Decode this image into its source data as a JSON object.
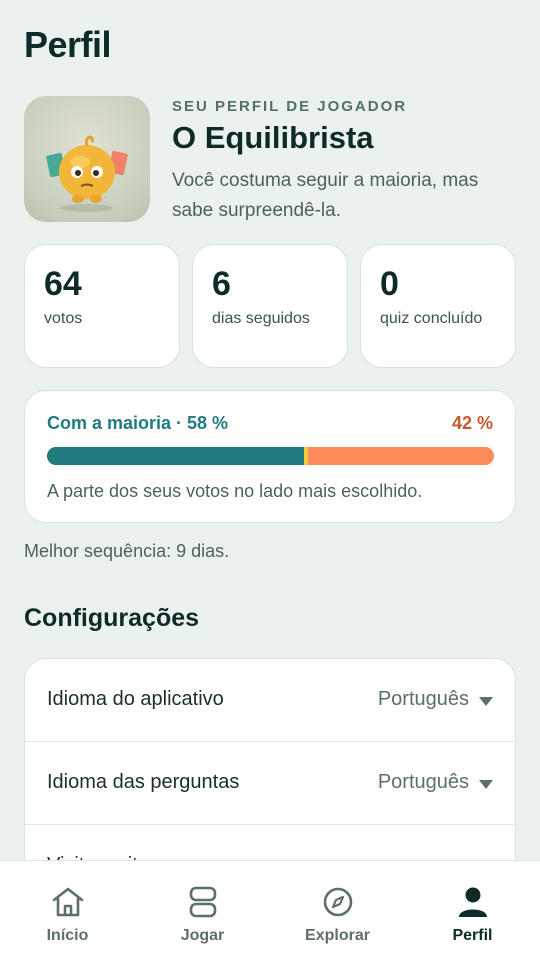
{
  "header": {
    "title": "Perfil"
  },
  "profile": {
    "kicker": "SEU PERFIL DE JOGADOR",
    "name": "O Equilibrista",
    "description": "Você costuma seguir a maioria, mas sabe surpreendê-la."
  },
  "stats": [
    {
      "value": "64",
      "label": "votos"
    },
    {
      "value": "6",
      "label": "dias seguidos"
    },
    {
      "value": "0",
      "label": "quiz concluído"
    }
  ],
  "majority": {
    "left_label": "Com a maioria · 58 %",
    "right_label": "42 %",
    "majority_percent": 58,
    "caption": "A parte dos seus votos no lado mais escolhido.",
    "colors": {
      "majority": "#237a7f",
      "minority": "#ff8c5a",
      "marker": "#f5c93a"
    }
  },
  "best_streak": "Melhor sequência: 9 dias.",
  "settings": {
    "title": "Configurações",
    "rows": [
      {
        "label": "Idioma do aplicativo",
        "value": "Português",
        "icon": "chevron-down-icon"
      },
      {
        "label": "Idioma das perguntas",
        "value": "Português",
        "icon": "chevron-down-icon"
      },
      {
        "label": "Visite o site",
        "icon": "chevron-right-icon"
      }
    ]
  },
  "nav": {
    "items": [
      {
        "label": "Início",
        "icon": "home-icon"
      },
      {
        "label": "Jogar",
        "icon": "cards-icon"
      },
      {
        "label": "Explorar",
        "icon": "compass-icon"
      },
      {
        "label": "Perfil",
        "icon": "person-icon",
        "active": true
      }
    ]
  }
}
